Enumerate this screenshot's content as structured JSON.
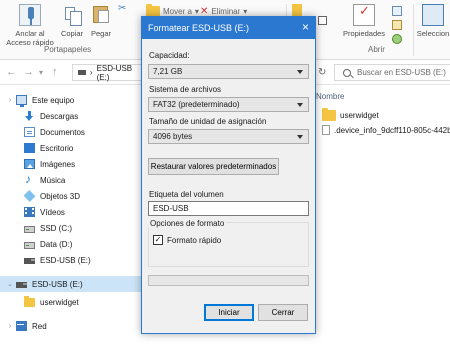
{
  "ribbon": {
    "pin": {
      "label_line1": "Anclar al",
      "label_line2": "Acceso rápido"
    },
    "copy_label": "Copiar",
    "paste_label": "Pegar",
    "move_label": "Mover a",
    "delete_label": "Eliminar",
    "properties_label": "Propiedades",
    "selection_label": "Seleccion",
    "group_clipboard": "Portapapeles",
    "group_open": "Abrir"
  },
  "address": {
    "path": "ESD-USB (E:)",
    "search_placeholder": "Buscar en ESD-USB (E:)"
  },
  "nav": {
    "items": [
      {
        "label": "Este equipo",
        "icon": "this-pc-icon"
      },
      {
        "label": "Descargas",
        "icon": "downloads-icon"
      },
      {
        "label": "Documentos",
        "icon": "documents-icon"
      },
      {
        "label": "Escritorio",
        "icon": "desktop-icon"
      },
      {
        "label": "Imágenes",
        "icon": "pictures-icon"
      },
      {
        "label": "Música",
        "icon": "music-icon"
      },
      {
        "label": "Objetos 3D",
        "icon": "3d-objects-icon"
      },
      {
        "label": "Vídeos",
        "icon": "videos-icon"
      },
      {
        "label": "SSD (C:)",
        "icon": "drive-icon"
      },
      {
        "label": "Data (D:)",
        "icon": "drive-icon"
      },
      {
        "label": "ESD-USB (E:)",
        "icon": "usb-drive-icon"
      },
      {
        "label": "ESD-USB (E:)",
        "icon": "usb-drive-icon"
      },
      {
        "label": "userwidget",
        "icon": "folder-icon"
      },
      {
        "label": "Red",
        "icon": "network-icon"
      }
    ]
  },
  "files": {
    "column_name": "Nombre",
    "items": [
      {
        "name": "userwidget",
        "type": "folder"
      },
      {
        "name": ".device_info_9dcff110-805c-442b",
        "type": "file"
      }
    ]
  },
  "dialog": {
    "title": "Formatear ESD-USB (E:)",
    "capacity_label": "Capacidad:",
    "capacity_value": "7,21 GB",
    "filesystem_label": "Sistema de archivos",
    "filesystem_value": "FAT32 (predeterminado)",
    "alloc_label": "Tamaño de unidad de asignación",
    "alloc_value": "4096 bytes",
    "restore_button": "Restaurar valores predeterminados",
    "volume_label": "Etiqueta del volumen",
    "volume_value": "ESD-USB",
    "format_options_label": "Opciones de formato",
    "quick_format_label": "Formato rápido",
    "quick_format_checked": true,
    "progress": 0,
    "start_button": "Iniciar",
    "close_button": "Cerrar"
  },
  "colors": {
    "accent": "#2b78d0",
    "selection": "#cce4f7",
    "folder": "#f4c542"
  }
}
